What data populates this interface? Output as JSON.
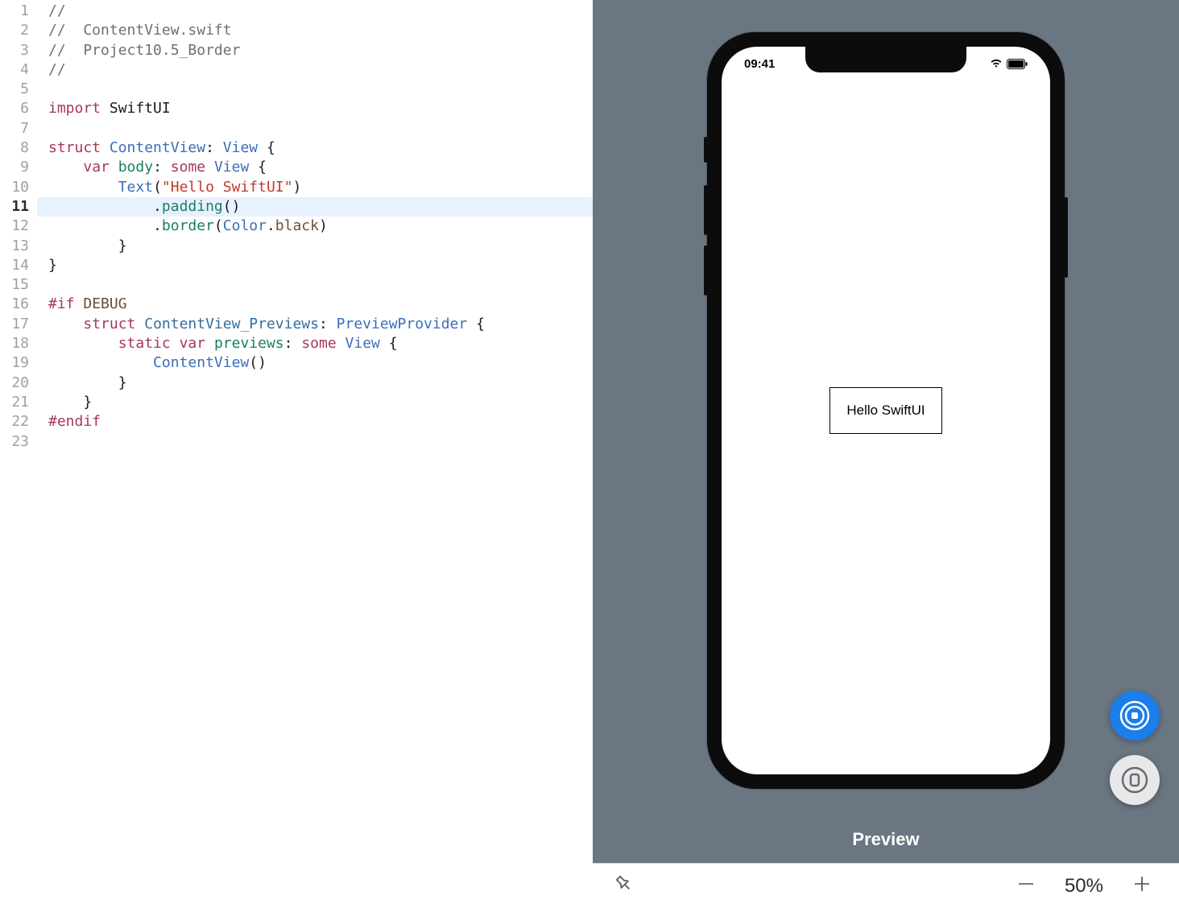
{
  "editor": {
    "highlighted_line": 11,
    "lines": [
      [
        {
          "t": "//",
          "c": "comment"
        }
      ],
      [
        {
          "t": "//  ContentView.swift",
          "c": "comment"
        }
      ],
      [
        {
          "t": "//  Project10.5_Border",
          "c": "comment"
        }
      ],
      [
        {
          "t": "//",
          "c": "comment"
        }
      ],
      [],
      [
        {
          "t": "import",
          "c": "keyword"
        },
        {
          "t": " ",
          "c": "default"
        },
        {
          "t": "SwiftUI",
          "c": "default"
        }
      ],
      [],
      [
        {
          "t": "struct",
          "c": "keyword"
        },
        {
          "t": " ",
          "c": "default"
        },
        {
          "t": "ContentView",
          "c": "type"
        },
        {
          "t": ": ",
          "c": "default"
        },
        {
          "t": "View",
          "c": "type"
        },
        {
          "t": " {",
          "c": "default"
        }
      ],
      [
        {
          "t": "    ",
          "c": "default"
        },
        {
          "t": "var",
          "c": "keyword"
        },
        {
          "t": " ",
          "c": "default"
        },
        {
          "t": "body",
          "c": "func"
        },
        {
          "t": ": ",
          "c": "default"
        },
        {
          "t": "some",
          "c": "keyword"
        },
        {
          "t": " ",
          "c": "default"
        },
        {
          "t": "View",
          "c": "type"
        },
        {
          "t": " {",
          "c": "default"
        }
      ],
      [
        {
          "t": "        ",
          "c": "default"
        },
        {
          "t": "Text",
          "c": "type"
        },
        {
          "t": "(",
          "c": "default"
        },
        {
          "t": "\"Hello SwiftUI\"",
          "c": "string"
        },
        {
          "t": ")",
          "c": "default"
        }
      ],
      [
        {
          "t": "            .",
          "c": "default"
        },
        {
          "t": "padding",
          "c": "func"
        },
        {
          "t": "()",
          "c": "default"
        }
      ],
      [
        {
          "t": "            .",
          "c": "default"
        },
        {
          "t": "border",
          "c": "func"
        },
        {
          "t": "(",
          "c": "default"
        },
        {
          "t": "Color",
          "c": "type"
        },
        {
          "t": ".",
          "c": "default"
        },
        {
          "t": "black",
          "c": "member"
        },
        {
          "t": ")",
          "c": "default"
        }
      ],
      [
        {
          "t": "        }",
          "c": "default"
        }
      ],
      [
        {
          "t": "}",
          "c": "default"
        }
      ],
      [],
      [
        {
          "t": "#if",
          "c": "keyword"
        },
        {
          "t": " ",
          "c": "default"
        },
        {
          "t": "DEBUG",
          "c": "member"
        }
      ],
      [
        {
          "t": "    ",
          "c": "default"
        },
        {
          "t": "struct",
          "c": "keyword"
        },
        {
          "t": " ",
          "c": "default"
        },
        {
          "t": "ContentView_Previews",
          "c": "funcname"
        },
        {
          "t": ": ",
          "c": "default"
        },
        {
          "t": "PreviewProvider",
          "c": "type"
        },
        {
          "t": " {",
          "c": "default"
        }
      ],
      [
        {
          "t": "        ",
          "c": "default"
        },
        {
          "t": "static",
          "c": "keyword"
        },
        {
          "t": " ",
          "c": "default"
        },
        {
          "t": "var",
          "c": "keyword"
        },
        {
          "t": " ",
          "c": "default"
        },
        {
          "t": "previews",
          "c": "func"
        },
        {
          "t": ": ",
          "c": "default"
        },
        {
          "t": "some",
          "c": "keyword"
        },
        {
          "t": " ",
          "c": "default"
        },
        {
          "t": "View",
          "c": "type"
        },
        {
          "t": " {",
          "c": "default"
        }
      ],
      [
        {
          "t": "            ",
          "c": "default"
        },
        {
          "t": "ContentView",
          "c": "type"
        },
        {
          "t": "()",
          "c": "default"
        }
      ],
      [
        {
          "t": "        }",
          "c": "default"
        }
      ],
      [
        {
          "t": "    }",
          "c": "default"
        }
      ],
      [
        {
          "t": "#endif",
          "c": "keyword"
        }
      ],
      []
    ]
  },
  "preview": {
    "status_time": "09:41",
    "content_text": "Hello SwiftUI",
    "label": "Preview"
  },
  "toolbar": {
    "zoom_level": "50%"
  }
}
